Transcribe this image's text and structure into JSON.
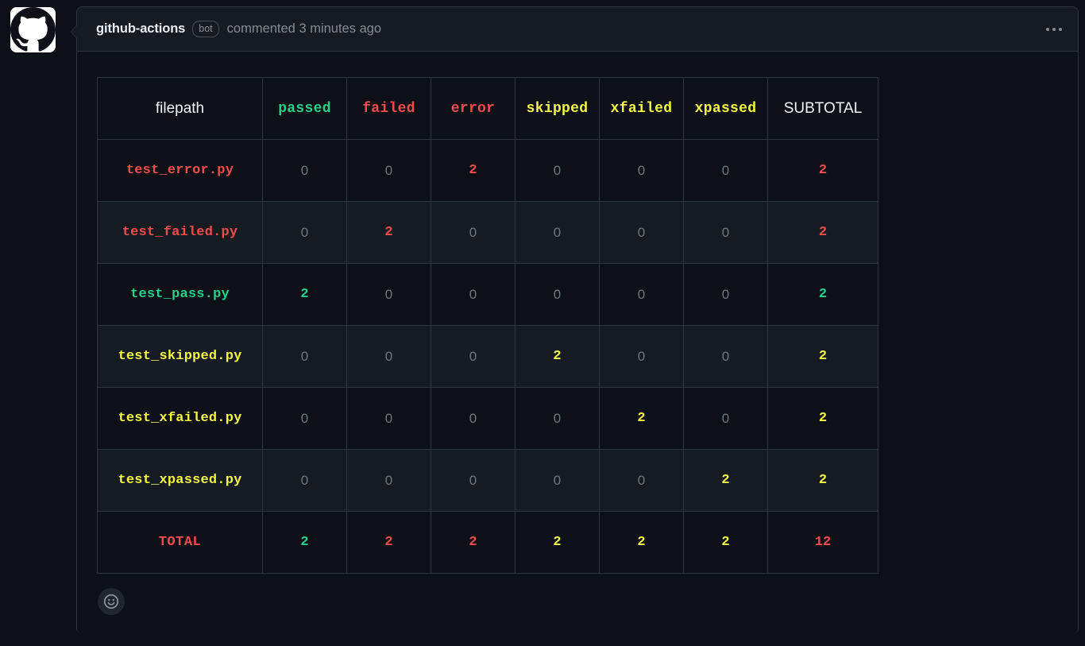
{
  "comment": {
    "author": "github-actions",
    "bot_badge": "bot",
    "commented_text": "commented 3 minutes ago",
    "avatar_icon": "github-logo-icon",
    "menu_icon": "kebab-horizontal-icon",
    "reaction_icon": "smiley-add-reaction-icon"
  },
  "colors": {
    "green": "#23d18b",
    "red": "#f14c4c",
    "yellow": "#f5f543",
    "white": "#f0f6fc",
    "zero_gray": "#6e7681",
    "background": "#0d1117",
    "header_background": "#161b22",
    "border": "#30363d"
  },
  "results": {
    "columns": [
      {
        "label": "filepath",
        "style": "sans",
        "color": "white"
      },
      {
        "label": "passed",
        "style": "mono",
        "color": "green"
      },
      {
        "label": "failed",
        "style": "mono",
        "color": "red"
      },
      {
        "label": "error",
        "style": "mono",
        "color": "red"
      },
      {
        "label": "skipped",
        "style": "mono",
        "color": "yellow"
      },
      {
        "label": "xfailed",
        "style": "mono",
        "color": "yellow"
      },
      {
        "label": "xpassed",
        "style": "mono",
        "color": "yellow"
      },
      {
        "label": "SUBTOTAL",
        "style": "sans",
        "color": "white"
      }
    ],
    "rows": [
      {
        "filepath": "test_error.py",
        "filepath_color": "red",
        "values": [
          "0",
          "0",
          "2",
          "0",
          "0",
          "0"
        ],
        "subtotal": "2",
        "subtotal_color": "red",
        "nonzero_index": 2,
        "nonzero_color": "red"
      },
      {
        "filepath": "test_failed.py",
        "filepath_color": "red",
        "values": [
          "0",
          "2",
          "0",
          "0",
          "0",
          "0"
        ],
        "subtotal": "2",
        "subtotal_color": "red",
        "nonzero_index": 1,
        "nonzero_color": "red"
      },
      {
        "filepath": "test_pass.py",
        "filepath_color": "green",
        "values": [
          "2",
          "0",
          "0",
          "0",
          "0",
          "0"
        ],
        "subtotal": "2",
        "subtotal_color": "green",
        "nonzero_index": 0,
        "nonzero_color": "green"
      },
      {
        "filepath": "test_skipped.py",
        "filepath_color": "yellow",
        "values": [
          "0",
          "0",
          "0",
          "2",
          "0",
          "0"
        ],
        "subtotal": "2",
        "subtotal_color": "yellow",
        "nonzero_index": 3,
        "nonzero_color": "yellow"
      },
      {
        "filepath": "test_xfailed.py",
        "filepath_color": "yellow",
        "values": [
          "0",
          "0",
          "0",
          "0",
          "2",
          "0"
        ],
        "subtotal": "2",
        "subtotal_color": "yellow",
        "nonzero_index": 4,
        "nonzero_color": "yellow"
      },
      {
        "filepath": "test_xpassed.py",
        "filepath_color": "yellow",
        "values": [
          "0",
          "0",
          "0",
          "0",
          "0",
          "2"
        ],
        "subtotal": "2",
        "subtotal_color": "yellow",
        "nonzero_index": 5,
        "nonzero_color": "yellow"
      }
    ],
    "total": {
      "label": "TOTAL",
      "label_color": "red",
      "values": [
        "2",
        "2",
        "2",
        "2",
        "2",
        "2"
      ],
      "value_colors": [
        "green",
        "red",
        "red",
        "yellow",
        "yellow",
        "yellow"
      ],
      "subtotal": "12",
      "subtotal_color": "red"
    }
  }
}
